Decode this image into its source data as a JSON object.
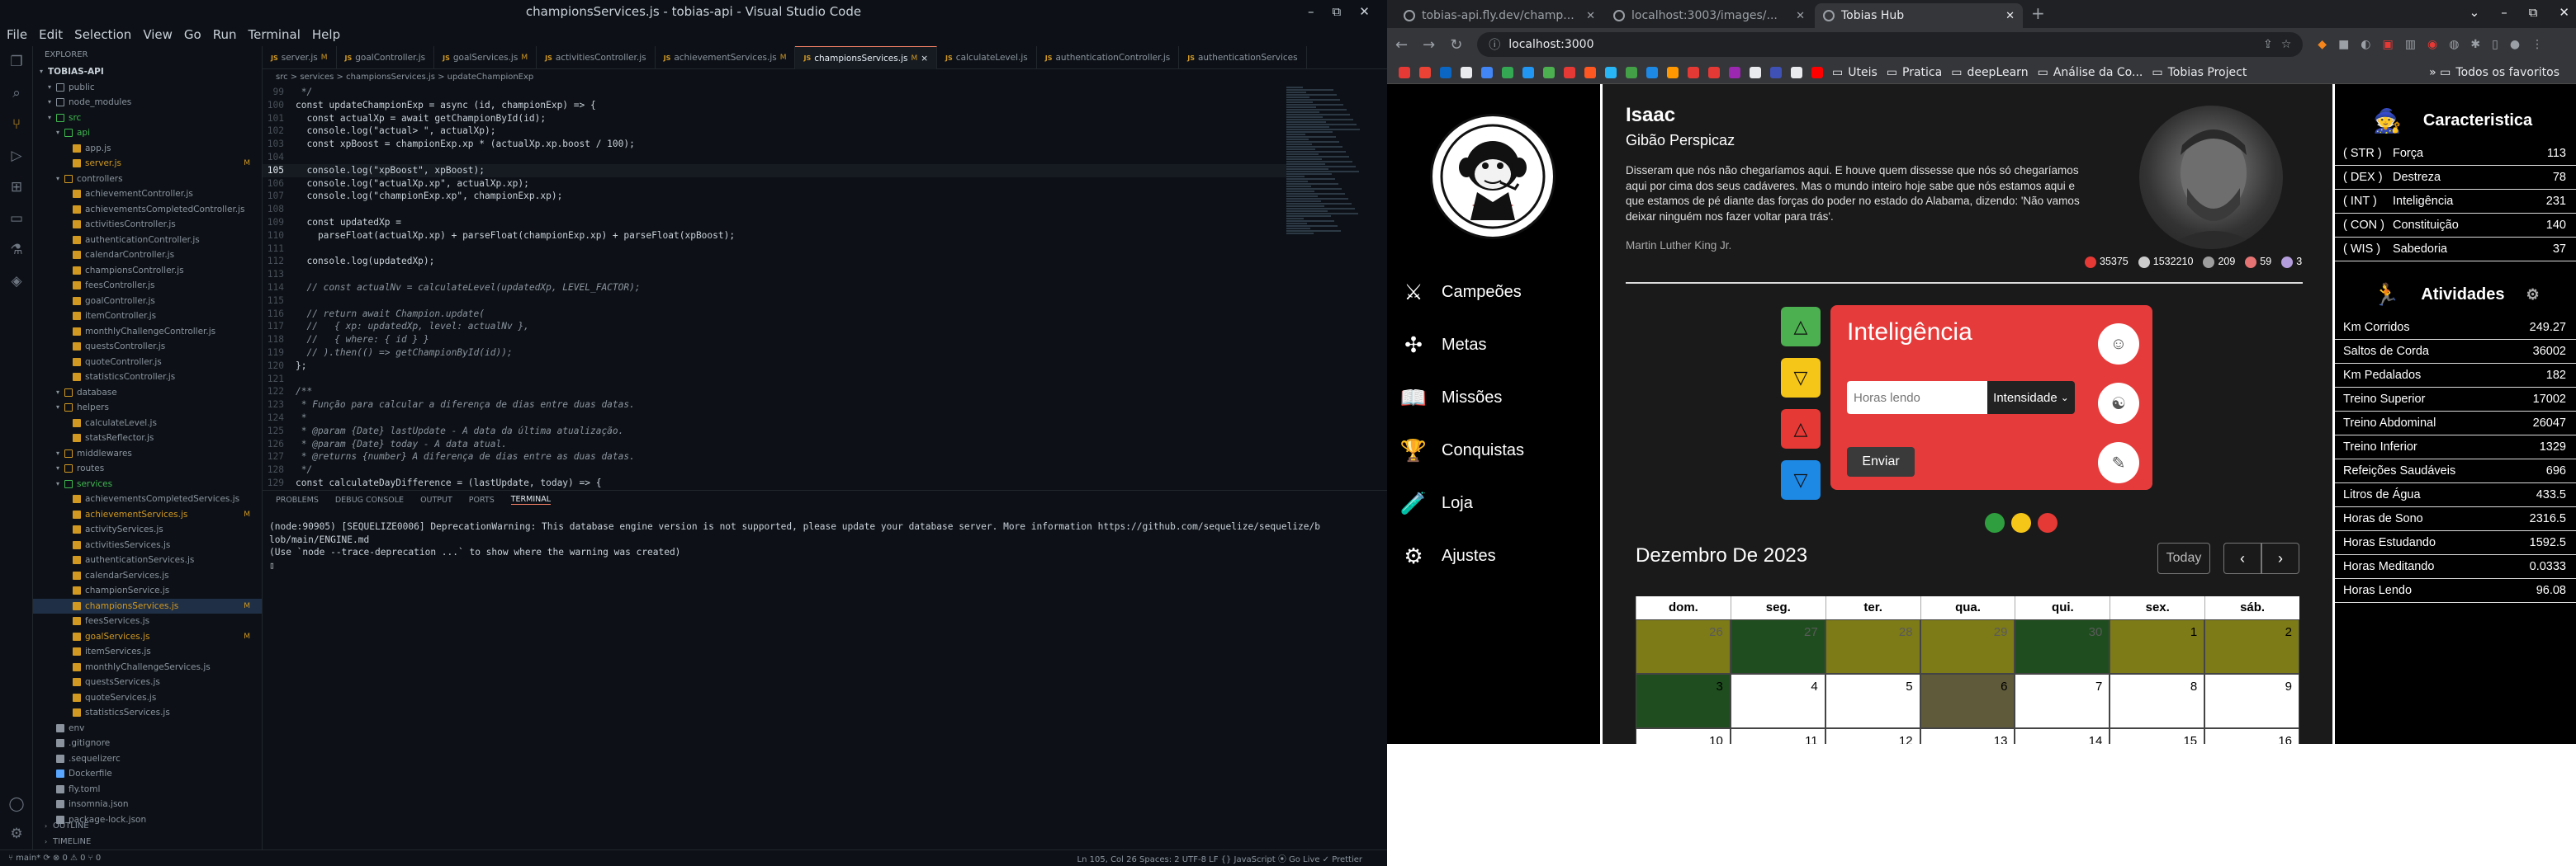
{
  "vscode": {
    "window_title": "championsServices.js - tobias-api - Visual Studio Code",
    "menu": [
      "File",
      "Edit",
      "Selection",
      "View",
      "Go",
      "Run",
      "Terminal",
      "Help"
    ],
    "explorer_title": "EXPLORER",
    "project": "TOBIAS-API",
    "tree": [
      {
        "label": "public",
        "depth": 1,
        "type": "folder",
        "badge": "",
        "color": "#8b949e"
      },
      {
        "label": "node_modules",
        "depth": 1,
        "type": "folder",
        "badge": "",
        "color": "#8b949e"
      },
      {
        "label": "src",
        "depth": 1,
        "type": "folder",
        "badge": "",
        "color": "#3fb950"
      },
      {
        "label": "api",
        "depth": 2,
        "type": "folder",
        "badge": "",
        "color": "#3fb950"
      },
      {
        "label": "app.js",
        "depth": 3,
        "type": "file",
        "badge": "",
        "color": "#d29922"
      },
      {
        "label": "server.js",
        "depth": 3,
        "type": "file",
        "badge": "M",
        "color": "#d29922"
      },
      {
        "label": "controllers",
        "depth": 2,
        "type": "folder",
        "badge": "",
        "color": "#d29922"
      },
      {
        "label": "achievementController.js",
        "depth": 3,
        "type": "file",
        "badge": "",
        "color": "#d29922"
      },
      {
        "label": "achievementsCompletedController.js",
        "depth": 3,
        "type": "file",
        "badge": "",
        "color": "#d29922"
      },
      {
        "label": "activitiesController.js",
        "depth": 3,
        "type": "file",
        "badge": "",
        "color": "#d29922"
      },
      {
        "label": "authenticationController.js",
        "depth": 3,
        "type": "file",
        "badge": "",
        "color": "#d29922"
      },
      {
        "label": "calendarController.js",
        "depth": 3,
        "type": "file",
        "badge": "",
        "color": "#d29922"
      },
      {
        "label": "championsController.js",
        "depth": 3,
        "type": "file",
        "badge": "",
        "color": "#d29922"
      },
      {
        "label": "feesController.js",
        "depth": 3,
        "type": "file",
        "badge": "",
        "color": "#d29922"
      },
      {
        "label": "goalController.js",
        "depth": 3,
        "type": "file",
        "badge": "",
        "color": "#d29922"
      },
      {
        "label": "itemController.js",
        "depth": 3,
        "type": "file",
        "badge": "",
        "color": "#d29922"
      },
      {
        "label": "monthlyChallengeController.js",
        "depth": 3,
        "type": "file",
        "badge": "",
        "color": "#d29922"
      },
      {
        "label": "questsController.js",
        "depth": 3,
        "type": "file",
        "badge": "",
        "color": "#d29922"
      },
      {
        "label": "quoteController.js",
        "depth": 3,
        "type": "file",
        "badge": "",
        "color": "#d29922"
      },
      {
        "label": "statisticsController.js",
        "depth": 3,
        "type": "file",
        "badge": "",
        "color": "#d29922"
      },
      {
        "label": "database",
        "depth": 2,
        "type": "folder",
        "badge": "",
        "color": "#d29922"
      },
      {
        "label": "helpers",
        "depth": 2,
        "type": "folder",
        "badge": "",
        "color": "#d29922"
      },
      {
        "label": "calculateLevel.js",
        "depth": 3,
        "type": "file",
        "badge": "",
        "color": "#d29922"
      },
      {
        "label": "statsReflector.js",
        "depth": 3,
        "type": "file",
        "badge": "",
        "color": "#d29922"
      },
      {
        "label": "middlewares",
        "depth": 2,
        "type": "folder",
        "badge": "",
        "color": "#d29922"
      },
      {
        "label": "routes",
        "depth": 2,
        "type": "folder",
        "badge": "",
        "color": "#d29922"
      },
      {
        "label": "services",
        "depth": 2,
        "type": "folder",
        "badge": "",
        "color": "#3fb950"
      },
      {
        "label": "achievementsCompletedServices.js",
        "depth": 3,
        "type": "file",
        "badge": "",
        "color": "#d29922"
      },
      {
        "label": "achievementServices.js",
        "depth": 3,
        "type": "file",
        "badge": "M",
        "color": "#d29922"
      },
      {
        "label": "activityServices.js",
        "depth": 3,
        "type": "file",
        "badge": "",
        "color": "#d29922"
      },
      {
        "label": "activitiesServices.js",
        "depth": 3,
        "type": "file",
        "badge": "",
        "color": "#d29922"
      },
      {
        "label": "authenticationServices.js",
        "depth": 3,
        "type": "file",
        "badge": "",
        "color": "#d29922"
      },
      {
        "label": "calendarServices.js",
        "depth": 3,
        "type": "file",
        "badge": "",
        "color": "#d29922"
      },
      {
        "label": "championService.js",
        "depth": 3,
        "type": "file",
        "badge": "",
        "color": "#d29922"
      },
      {
        "label": "championsServices.js",
        "depth": 3,
        "type": "file",
        "badge": "M",
        "color": "#d29922",
        "selected": true
      },
      {
        "label": "feesServices.js",
        "depth": 3,
        "type": "file",
        "badge": "",
        "color": "#d29922"
      },
      {
        "label": "goalServices.js",
        "depth": 3,
        "type": "file",
        "badge": "M",
        "color": "#d29922"
      },
      {
        "label": "itemServices.js",
        "depth": 3,
        "type": "file",
        "badge": "",
        "color": "#d29922"
      },
      {
        "label": "monthlyChallengeServices.js",
        "depth": 3,
        "type": "file",
        "badge": "",
        "color": "#d29922"
      },
      {
        "label": "questsServices.js",
        "depth": 3,
        "type": "file",
        "badge": "",
        "color": "#d29922"
      },
      {
        "label": "quoteServices.js",
        "depth": 3,
        "type": "file",
        "badge": "",
        "color": "#d29922"
      },
      {
        "label": "statisticsServices.js",
        "depth": 3,
        "type": "file",
        "badge": "",
        "color": "#d29922"
      },
      {
        "label": "env",
        "depth": 1,
        "type": "file",
        "badge": "",
        "color": "#8b949e"
      },
      {
        "label": ".gitignore",
        "depth": 1,
        "type": "file",
        "badge": "",
        "color": "#8b949e"
      },
      {
        "label": ".sequelizerc",
        "depth": 1,
        "type": "file",
        "badge": "",
        "color": "#8b949e"
      },
      {
        "label": "Dockerfile",
        "depth": 1,
        "type": "file",
        "badge": "",
        "color": "#58a6ff"
      },
      {
        "label": "fly.toml",
        "depth": 1,
        "type": "file",
        "badge": "",
        "color": "#8b949e"
      },
      {
        "label": "insomnia.json",
        "depth": 1,
        "type": "file",
        "badge": "",
        "color": "#8b949e"
      },
      {
        "label": "package-lock.json",
        "depth": 1,
        "type": "file",
        "badge": "",
        "color": "#8b949e"
      }
    ],
    "outline": "OUTLINE",
    "timeline": "TIMELINE",
    "tabs": [
      {
        "label": "server.js",
        "m": "M",
        "active": false
      },
      {
        "label": "goalController.js",
        "m": "",
        "active": false
      },
      {
        "label": "goalServices.js",
        "m": "M",
        "active": false
      },
      {
        "label": "activitiesController.js",
        "m": "",
        "active": false
      },
      {
        "label": "achievementServices.js",
        "m": "M",
        "active": false
      },
      {
        "label": "championsServices.js",
        "m": "M",
        "active": true
      },
      {
        "label": "calculateLevel.js",
        "m": "",
        "active": false
      },
      {
        "label": "authenticationController.js",
        "m": "",
        "active": false
      },
      {
        "label": "authenticationServices",
        "m": "",
        "active": false
      }
    ],
    "breadcrumb": "src > services > championsServices.js > updateChampionExp",
    "code_lines": [
      {
        "n": "99",
        "t": " */",
        "cls": "c"
      },
      {
        "n": "100",
        "t": "const updateChampionExp = async (id, championExp) => {",
        "cls": "ct"
      },
      {
        "n": "101",
        "t": "  const actualXp = await getChampionById(id);",
        "cls": "ct"
      },
      {
        "n": "102",
        "t": "  console.log(\"actual> \", actualXp);",
        "cls": "ct"
      },
      {
        "n": "103",
        "t": "  const xpBoost = championExp.xp * (actualXp.xp.boost / 100);",
        "cls": "ct"
      },
      {
        "n": "104",
        "t": "",
        "cls": "ct"
      },
      {
        "n": "105",
        "t": "  console.log(\"xpBoost\", xpBoost);",
        "cls": "ct"
      },
      {
        "n": "106",
        "t": "  console.log(\"actualXp.xp\", actualXp.xp);",
        "cls": "ct"
      },
      {
        "n": "107",
        "t": "  console.log(\"championExp.xp\", championExp.xp);",
        "cls": "ct"
      },
      {
        "n": "108",
        "t": "",
        "cls": "ct"
      },
      {
        "n": "109",
        "t": "  const updatedXp =",
        "cls": "ct"
      },
      {
        "n": "110",
        "t": "    parseFloat(actualXp.xp) + parseFloat(championExp.xp) + parseFloat(xpBoost);",
        "cls": "ct"
      },
      {
        "n": "111",
        "t": "",
        "cls": "ct"
      },
      {
        "n": "112",
        "t": "  console.log(updatedXp);",
        "cls": "ct"
      },
      {
        "n": "113",
        "t": "",
        "cls": "ct"
      },
      {
        "n": "114",
        "t": "  // const actualNv = calculateLevel(updatedXp, LEVEL_FACTOR);",
        "cls": "c"
      },
      {
        "n": "115",
        "t": "",
        "cls": "ct"
      },
      {
        "n": "116",
        "t": "  // return await Champion.update(",
        "cls": "c"
      },
      {
        "n": "117",
        "t": "  //   { xp: updatedXp, level: actualNv },",
        "cls": "c"
      },
      {
        "n": "118",
        "t": "  //   { where: { id } }",
        "cls": "c"
      },
      {
        "n": "119",
        "t": "  // ).then(() => getChampionById(id));",
        "cls": "c"
      },
      {
        "n": "120",
        "t": "};",
        "cls": "ct"
      },
      {
        "n": "121",
        "t": "",
        "cls": "ct"
      },
      {
        "n": "122",
        "t": "/**",
        "cls": "c"
      },
      {
        "n": "123",
        "t": " * Função para calcular a diferença de dias entre duas datas.",
        "cls": "c"
      },
      {
        "n": "124",
        "t": " *",
        "cls": "c"
      },
      {
        "n": "125",
        "t": " * @param {Date} lastUpdate - A data da última atualização.",
        "cls": "c"
      },
      {
        "n": "126",
        "t": " * @param {Date} today - A data atual.",
        "cls": "c"
      },
      {
        "n": "127",
        "t": " * @returns {number} A diferença de dias entre as duas datas.",
        "cls": "c"
      },
      {
        "n": "128",
        "t": " */",
        "cls": "c"
      },
      {
        "n": "129",
        "t": "const calculateDayDifference = (lastUpdate, today) => {",
        "cls": "ct"
      }
    ],
    "panel_tabs": [
      "PROBLEMS",
      "DEBUG CONSOLE",
      "OUTPUT",
      "PORTS",
      "TERMINAL"
    ],
    "terminal": "(node:90905) [SEQUELIZE0006] DeprecationWarning: This database engine version is not supported, please update your database server. More information https://github.com/sequelize/sequelize/b\nlob/main/ENGINE.md\n(Use `node --trace-deprecation ...` to show where the warning was created)\n▯",
    "status_left": "⑂ main*  ⟳  ⊗ 0 ⚠ 0   ⑂ 0",
    "status_right": "Ln 105, Col 26   Spaces: 2   UTF-8   LF   {} JavaScript   ⦿ Go Live   ✓ Prettier"
  },
  "chrome": {
    "tabs": [
      {
        "label": "tobias-api.fly.dev/champ...",
        "active": false
      },
      {
        "label": "localhost:3003/images/...",
        "active": false
      },
      {
        "label": "Tobias Hub",
        "active": true
      }
    ],
    "url": "localhost:3000",
    "bookmarks": [
      "Uteis",
      "Pratica",
      "deepLearn",
      "Análise da Co...",
      "Tobias Project"
    ],
    "bookmarks_all": "Todos os favoritos"
  },
  "app": {
    "nav": [
      {
        "label": "Campeões",
        "icon": "⚔"
      },
      {
        "label": "Metas",
        "icon": "✣"
      },
      {
        "label": "Missões",
        "icon": "📖"
      },
      {
        "label": "Conquistas",
        "icon": "🏆"
      },
      {
        "label": "Loja",
        "icon": "🧪"
      },
      {
        "label": "Ajustes",
        "icon": "⚙"
      }
    ],
    "profile": {
      "name": "Isaac",
      "title": "Gibão Perspicaz",
      "quote": "Disseram que nós não chegaríamos aqui. E houve quem dissesse que nós só chegaríamos aqui por cima dos seus cadáveres. Mas o mundo inteiro hoje sabe que nós estamos aqui e que estamos de pé diante das forças do poder no estado do Alabama, dizendo: 'Não vamos deixar ninguém nos fazer voltar para trás'.",
      "author": "Martin Luther King Jr.",
      "stats": [
        {
          "value": "35375",
          "color": "#e53935"
        },
        {
          "value": "1532210",
          "color": "#cccccc"
        },
        {
          "value": "209",
          "color": "#9e9e9e"
        },
        {
          "value": "59",
          "color": "#e57373"
        },
        {
          "value": "3",
          "color": "#b39ddb"
        }
      ]
    },
    "skill": {
      "title": "Inteligência",
      "input_placeholder": "Horas lendo",
      "select_value": "Intensidade",
      "send_label": "Enviar",
      "arrow_colors": [
        "#4caf50",
        "#f5c518",
        "#e53935",
        "#1e88e5"
      ],
      "dots": [
        "#2e9e3e",
        "#f5c518",
        "#e53935"
      ]
    },
    "calendar": {
      "month_label": "Dezembro De 2023",
      "today_label": "Today",
      "weekdays": [
        "dom.",
        "seg.",
        "ter.",
        "qua.",
        "qui.",
        "sex.",
        "sáb."
      ],
      "weeks": [
        [
          {
            "d": "26",
            "bg": "#7d7a18",
            "dim": true
          },
          {
            "d": "27",
            "bg": "#1f4d1f",
            "dim": true
          },
          {
            "d": "28",
            "bg": "#7d7a18",
            "dim": true
          },
          {
            "d": "29",
            "bg": "#7d7a18",
            "dim": true
          },
          {
            "d": "30",
            "bg": "#1f4d1f",
            "dim": true
          },
          {
            "d": "1",
            "bg": "#7d7a18",
            "dim": false
          },
          {
            "d": "2",
            "bg": "#7d7a18",
            "dim": false
          }
        ],
        [
          {
            "d": "3",
            "bg": "#1f4d1f",
            "dim": false
          },
          {
            "d": "4",
            "bg": "#ffffff",
            "dim": false
          },
          {
            "d": "5",
            "bg": "#ffffff",
            "dim": false
          },
          {
            "d": "6",
            "bg": "#5e5a3a",
            "dim": false
          },
          {
            "d": "7",
            "bg": "#ffffff",
            "dim": false
          },
          {
            "d": "8",
            "bg": "#ffffff",
            "dim": false
          },
          {
            "d": "9",
            "bg": "#ffffff",
            "dim": false
          }
        ],
        [
          {
            "d": "10",
            "bg": "#ffffff",
            "dim": false
          },
          {
            "d": "11",
            "bg": "#ffffff",
            "dim": false
          },
          {
            "d": "12",
            "bg": "#ffffff",
            "dim": false
          },
          {
            "d": "13",
            "bg": "#ffffff",
            "dim": false
          },
          {
            "d": "14",
            "bg": "#ffffff",
            "dim": false
          },
          {
            "d": "15",
            "bg": "#ffffff",
            "dim": false
          },
          {
            "d": "16",
            "bg": "#ffffff",
            "dim": false
          }
        ]
      ]
    },
    "characteristics": {
      "title": "Caracteristica",
      "rows": [
        {
          "key": "( STR )",
          "name": "Força",
          "value": "113"
        },
        {
          "key": "( DEX )",
          "name": "Destreza",
          "value": "78"
        },
        {
          "key": "( INT )",
          "name": "Inteligência",
          "value": "231"
        },
        {
          "key": "( CON )",
          "name": "Constituição",
          "value": "140"
        },
        {
          "key": "( WIS )",
          "name": "Sabedoria",
          "value": "37"
        }
      ]
    },
    "activities": {
      "title": "Atividades",
      "rows": [
        {
          "name": "Km Corridos",
          "value": "249.27"
        },
        {
          "name": "Saltos de Corda",
          "value": "36002"
        },
        {
          "name": "Km Pedalados",
          "value": "182"
        },
        {
          "name": "Treino Superior",
          "value": "17002"
        },
        {
          "name": "Treino Abdominal",
          "value": "26047"
        },
        {
          "name": "Treino Inferior",
          "value": "1329"
        },
        {
          "name": "Refeições Saudáveis",
          "value": "696"
        },
        {
          "name": "Litros de Água",
          "value": "433.5"
        },
        {
          "name": "Horas de Sono",
          "value": "2316.5"
        },
        {
          "name": "Horas Estudando",
          "value": "1592.5"
        },
        {
          "name": "Horas Meditando",
          "value": "0.0333"
        },
        {
          "name": "Horas Lendo",
          "value": "96.08"
        }
      ]
    }
  }
}
